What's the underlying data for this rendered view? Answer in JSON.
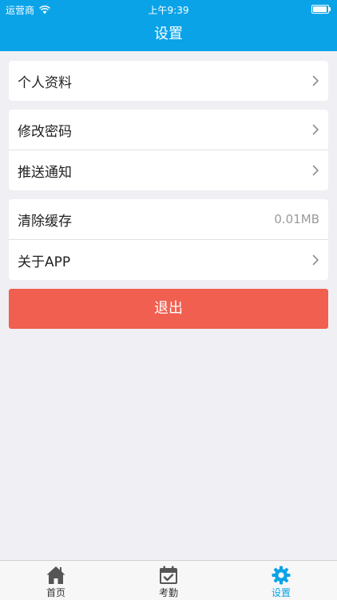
{
  "status_bar": {
    "carrier": "运营商",
    "time": "上午9:39"
  },
  "nav": {
    "title": "设置"
  },
  "groups": [
    {
      "rows": [
        {
          "label": "个人资料",
          "accessory": "chevron"
        }
      ]
    },
    {
      "rows": [
        {
          "label": "修改密码",
          "accessory": "chevron"
        },
        {
          "label": "推送通知",
          "accessory": "chevron"
        }
      ]
    },
    {
      "rows": [
        {
          "label": "清除缓存",
          "value": "0.01MB"
        },
        {
          "label": "关于APP",
          "accessory": "chevron"
        }
      ]
    }
  ],
  "logout_label": "退出",
  "tabs": [
    {
      "label": "首页",
      "icon": "home-icon",
      "active": false
    },
    {
      "label": "考勤",
      "icon": "calendar-check-icon",
      "active": false
    },
    {
      "label": "设置",
      "icon": "gear-icon",
      "active": true
    }
  ],
  "colors": {
    "primary": "#0aa3e8",
    "danger": "#f05f50",
    "background": "#efeff4",
    "tab_inactive": "#555555"
  }
}
